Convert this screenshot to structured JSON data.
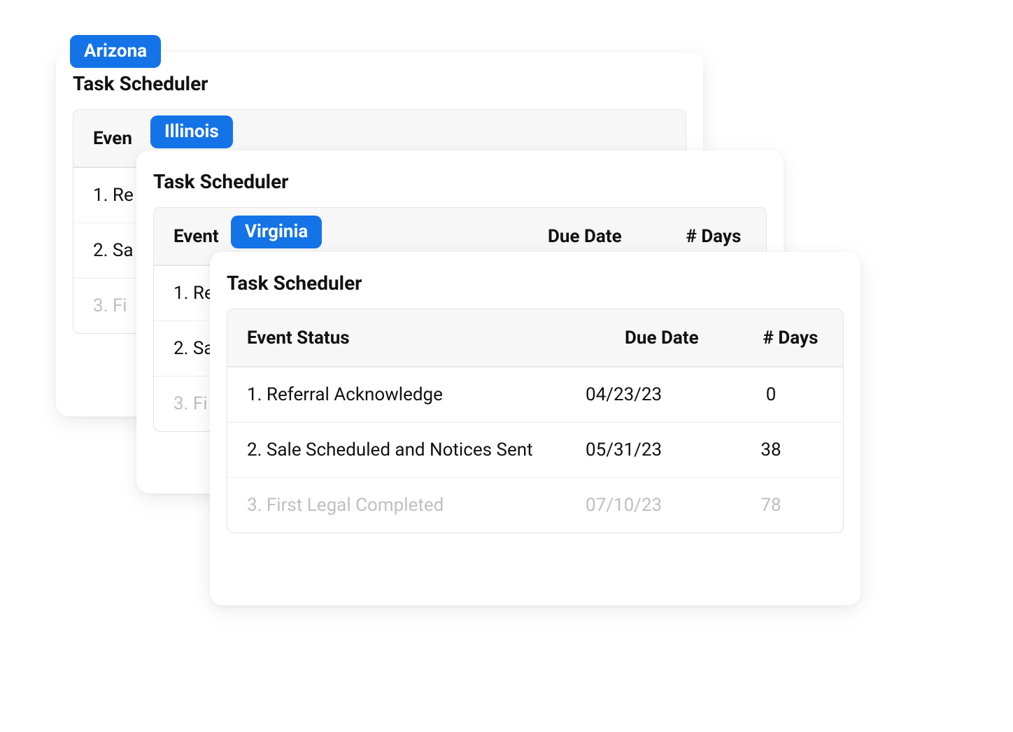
{
  "tags": {
    "a": "Arizona",
    "b": "Illinois",
    "c": "Virginia"
  },
  "title": "Task Scheduler",
  "headers": {
    "event": "Event Status",
    "due": "Due Date",
    "days": "# Days"
  },
  "rows": [
    {
      "event": "1. Referral Acknowledge",
      "due": "04/23/23",
      "days": "0",
      "muted": false
    },
    {
      "event": "2. Sale Scheduled and Notices Sent",
      "due": "05/31/23",
      "days": "38",
      "muted": false
    },
    {
      "event": "3. First Legal Completed",
      "due": "07/10/23",
      "days": "78",
      "muted": true
    }
  ],
  "partial": {
    "a": {
      "header": "Even",
      "rows": [
        "1. Re",
        "2. Sa",
        "3. Fi"
      ]
    },
    "b": {
      "header": "Event",
      "due": "Due Date",
      "days": "# Days",
      "rows": [
        "1. Re",
        "2. Sa",
        "3. Fi"
      ]
    }
  }
}
